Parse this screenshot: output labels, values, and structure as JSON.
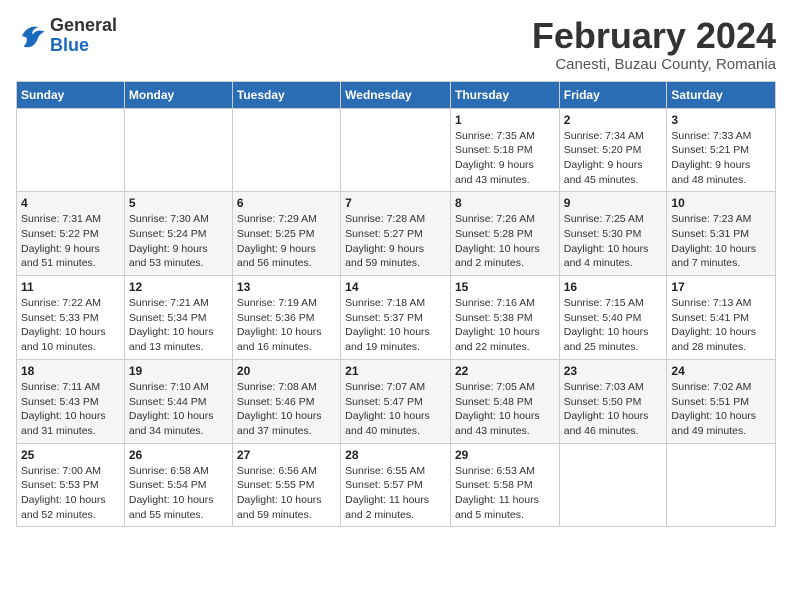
{
  "logo": {
    "general": "General",
    "blue": "Blue"
  },
  "title": "February 2024",
  "subtitle": "Canesti, Buzau County, Romania",
  "days_of_week": [
    "Sunday",
    "Monday",
    "Tuesday",
    "Wednesday",
    "Thursday",
    "Friday",
    "Saturday"
  ],
  "weeks": [
    [
      {
        "day": "",
        "info": ""
      },
      {
        "day": "",
        "info": ""
      },
      {
        "day": "",
        "info": ""
      },
      {
        "day": "",
        "info": ""
      },
      {
        "day": "1",
        "info": "Sunrise: 7:35 AM\nSunset: 5:18 PM\nDaylight: 9 hours\nand 43 minutes."
      },
      {
        "day": "2",
        "info": "Sunrise: 7:34 AM\nSunset: 5:20 PM\nDaylight: 9 hours\nand 45 minutes."
      },
      {
        "day": "3",
        "info": "Sunrise: 7:33 AM\nSunset: 5:21 PM\nDaylight: 9 hours\nand 48 minutes."
      }
    ],
    [
      {
        "day": "4",
        "info": "Sunrise: 7:31 AM\nSunset: 5:22 PM\nDaylight: 9 hours\nand 51 minutes."
      },
      {
        "day": "5",
        "info": "Sunrise: 7:30 AM\nSunset: 5:24 PM\nDaylight: 9 hours\nand 53 minutes."
      },
      {
        "day": "6",
        "info": "Sunrise: 7:29 AM\nSunset: 5:25 PM\nDaylight: 9 hours\nand 56 minutes."
      },
      {
        "day": "7",
        "info": "Sunrise: 7:28 AM\nSunset: 5:27 PM\nDaylight: 9 hours\nand 59 minutes."
      },
      {
        "day": "8",
        "info": "Sunrise: 7:26 AM\nSunset: 5:28 PM\nDaylight: 10 hours\nand 2 minutes."
      },
      {
        "day": "9",
        "info": "Sunrise: 7:25 AM\nSunset: 5:30 PM\nDaylight: 10 hours\nand 4 minutes."
      },
      {
        "day": "10",
        "info": "Sunrise: 7:23 AM\nSunset: 5:31 PM\nDaylight: 10 hours\nand 7 minutes."
      }
    ],
    [
      {
        "day": "11",
        "info": "Sunrise: 7:22 AM\nSunset: 5:33 PM\nDaylight: 10 hours\nand 10 minutes."
      },
      {
        "day": "12",
        "info": "Sunrise: 7:21 AM\nSunset: 5:34 PM\nDaylight: 10 hours\nand 13 minutes."
      },
      {
        "day": "13",
        "info": "Sunrise: 7:19 AM\nSunset: 5:36 PM\nDaylight: 10 hours\nand 16 minutes."
      },
      {
        "day": "14",
        "info": "Sunrise: 7:18 AM\nSunset: 5:37 PM\nDaylight: 10 hours\nand 19 minutes."
      },
      {
        "day": "15",
        "info": "Sunrise: 7:16 AM\nSunset: 5:38 PM\nDaylight: 10 hours\nand 22 minutes."
      },
      {
        "day": "16",
        "info": "Sunrise: 7:15 AM\nSunset: 5:40 PM\nDaylight: 10 hours\nand 25 minutes."
      },
      {
        "day": "17",
        "info": "Sunrise: 7:13 AM\nSunset: 5:41 PM\nDaylight: 10 hours\nand 28 minutes."
      }
    ],
    [
      {
        "day": "18",
        "info": "Sunrise: 7:11 AM\nSunset: 5:43 PM\nDaylight: 10 hours\nand 31 minutes."
      },
      {
        "day": "19",
        "info": "Sunrise: 7:10 AM\nSunset: 5:44 PM\nDaylight: 10 hours\nand 34 minutes."
      },
      {
        "day": "20",
        "info": "Sunrise: 7:08 AM\nSunset: 5:46 PM\nDaylight: 10 hours\nand 37 minutes."
      },
      {
        "day": "21",
        "info": "Sunrise: 7:07 AM\nSunset: 5:47 PM\nDaylight: 10 hours\nand 40 minutes."
      },
      {
        "day": "22",
        "info": "Sunrise: 7:05 AM\nSunset: 5:48 PM\nDaylight: 10 hours\nand 43 minutes."
      },
      {
        "day": "23",
        "info": "Sunrise: 7:03 AM\nSunset: 5:50 PM\nDaylight: 10 hours\nand 46 minutes."
      },
      {
        "day": "24",
        "info": "Sunrise: 7:02 AM\nSunset: 5:51 PM\nDaylight: 10 hours\nand 49 minutes."
      }
    ],
    [
      {
        "day": "25",
        "info": "Sunrise: 7:00 AM\nSunset: 5:53 PM\nDaylight: 10 hours\nand 52 minutes."
      },
      {
        "day": "26",
        "info": "Sunrise: 6:58 AM\nSunset: 5:54 PM\nDaylight: 10 hours\nand 55 minutes."
      },
      {
        "day": "27",
        "info": "Sunrise: 6:56 AM\nSunset: 5:55 PM\nDaylight: 10 hours\nand 59 minutes."
      },
      {
        "day": "28",
        "info": "Sunrise: 6:55 AM\nSunset: 5:57 PM\nDaylight: 11 hours\nand 2 minutes."
      },
      {
        "day": "29",
        "info": "Sunrise: 6:53 AM\nSunset: 5:58 PM\nDaylight: 11 hours\nand 5 minutes."
      },
      {
        "day": "",
        "info": ""
      },
      {
        "day": "",
        "info": ""
      }
    ]
  ]
}
